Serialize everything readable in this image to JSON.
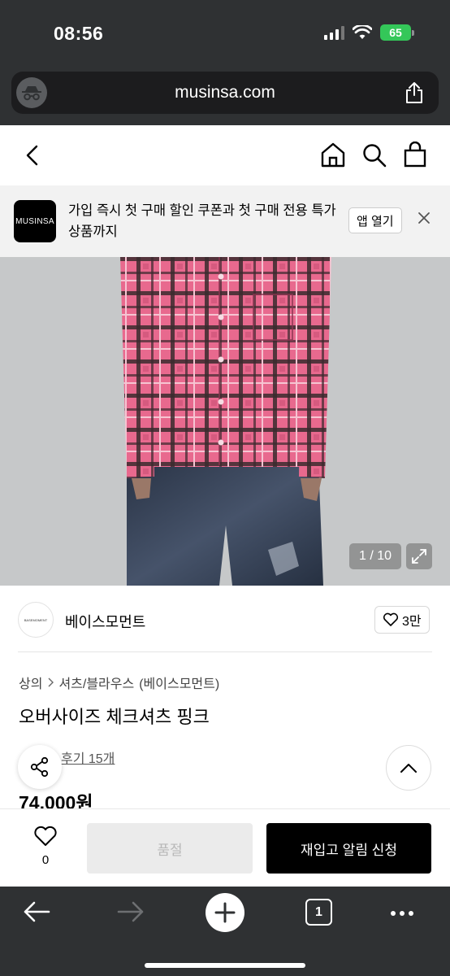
{
  "status_bar": {
    "time": "08:56",
    "battery": "65"
  },
  "browser": {
    "url": "musinsa.com",
    "tab_count": "1"
  },
  "banner": {
    "logo_text": "MUSINSA",
    "message": "가입 즉시 첫 구매 할인 쿠폰과 첫 구매 전용 특가 상품까지",
    "open_app_label": "앱 열기"
  },
  "gallery": {
    "counter": "1 / 10"
  },
  "brand": {
    "logo_text": "BASEMOMENT",
    "name": "베이스모먼트",
    "like_count": "3만"
  },
  "product": {
    "breadcrumb": [
      "상의",
      "셔츠/블라우스",
      "(베이스모먼트)"
    ],
    "title": "오버사이즈 체크셔츠 핑크",
    "review_text": "후기 15개",
    "price": "74,000원"
  },
  "purchase": {
    "wish_count": "0",
    "soldout_label": "품절",
    "restock_label": "재입고 알림 신청"
  },
  "colors": {
    "dark_chrome": "#2f3133",
    "battery_green": "#34c759",
    "shirt_pink": "#e6688c",
    "primary_button": "#000000"
  }
}
